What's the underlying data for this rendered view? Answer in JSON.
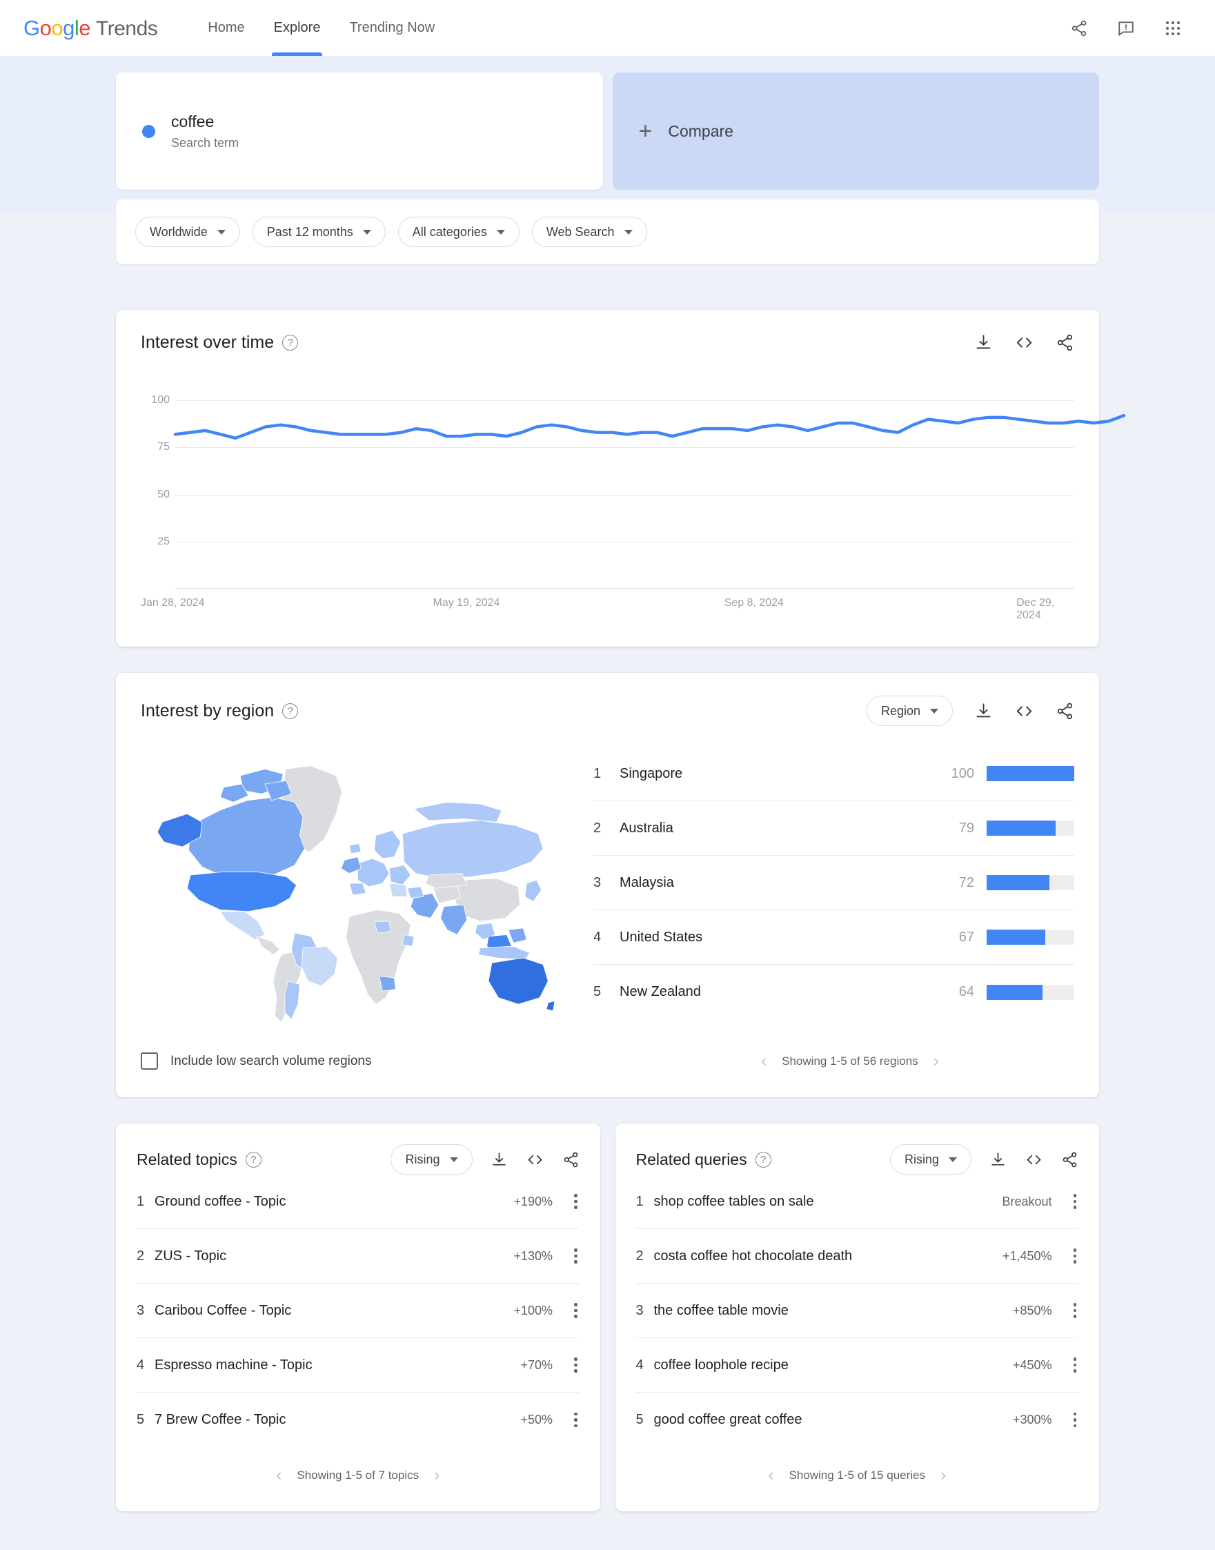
{
  "header": {
    "logo": {
      "g1": "G",
      "o1": "o",
      "o2": "o",
      "g2": "g",
      "l1": "l",
      "e1": "e",
      "trends": "Trends"
    },
    "nav": [
      {
        "label": "Home",
        "active": false
      },
      {
        "label": "Explore",
        "active": true
      },
      {
        "label": "Trending Now",
        "active": false
      }
    ],
    "icons": [
      "share-icon",
      "feedback-icon",
      "apps-grid-icon"
    ]
  },
  "query": {
    "term": "coffee",
    "term_type": "Search term",
    "compare_label": "Compare",
    "compare_plus": "+"
  },
  "filters": [
    {
      "label": "Worldwide",
      "name": "location-filter"
    },
    {
      "label": "Past 12 months",
      "name": "time-filter"
    },
    {
      "label": "All categories",
      "name": "category-filter"
    },
    {
      "label": "Web Search",
      "name": "search-type-filter"
    }
  ],
  "interest_over_time": {
    "title": "Interest over time",
    "help": "?"
  },
  "interest_by_region": {
    "title": "Interest by region",
    "help": "?",
    "selector": "Region",
    "checkbox_label": "Include low search volume regions",
    "pagination": "Showing 1-5 of 56 regions",
    "rows": [
      {
        "rank": "1",
        "name": "Singapore",
        "value": "100",
        "pct": 100
      },
      {
        "rank": "2",
        "name": "Australia",
        "value": "79",
        "pct": 79
      },
      {
        "rank": "3",
        "name": "Malaysia",
        "value": "72",
        "pct": 72
      },
      {
        "rank": "4",
        "name": "United States",
        "value": "67",
        "pct": 67
      },
      {
        "rank": "5",
        "name": "New Zealand",
        "value": "64",
        "pct": 64
      }
    ]
  },
  "related_topics": {
    "title": "Related topics",
    "help": "?",
    "selector": "Rising",
    "pagination": "Showing 1-5 of 7 topics",
    "rows": [
      {
        "rank": "1",
        "name": "Ground coffee - Topic",
        "value": "+190%"
      },
      {
        "rank": "2",
        "name": "ZUS - Topic",
        "value": "+130%"
      },
      {
        "rank": "3",
        "name": "Caribou Coffee - Topic",
        "value": "+100%"
      },
      {
        "rank": "4",
        "name": "Espresso machine - Topic",
        "value": "+70%"
      },
      {
        "rank": "5",
        "name": "7 Brew Coffee - Topic",
        "value": "+50%"
      }
    ]
  },
  "related_queries": {
    "title": "Related queries",
    "help": "?",
    "selector": "Rising",
    "pagination": "Showing 1-5 of 15 queries",
    "rows": [
      {
        "rank": "1",
        "name": "shop coffee tables on sale",
        "value": "Breakout"
      },
      {
        "rank": "2",
        "name": "costa coffee hot chocolate death",
        "value": "+1,450%"
      },
      {
        "rank": "3",
        "name": "the coffee table movie",
        "value": "+850%"
      },
      {
        "rank": "4",
        "name": "coffee loophole recipe",
        "value": "+450%"
      },
      {
        "rank": "5",
        "name": "good coffee great coffee",
        "value": "+300%"
      }
    ]
  },
  "pager_icons": {
    "prev": "‹",
    "next": "›"
  },
  "colors": {
    "accent": "#4285F4",
    "band_bg": "#e8eefc",
    "page_bg": "#eef1f8",
    "bar_track": "#eeeeee",
    "map_none": "#dadce0"
  },
  "chart_data": {
    "type": "line",
    "title": "Interest over time",
    "xlabel": "",
    "ylabel": "",
    "ylim": [
      0,
      110
    ],
    "yticks": [
      100,
      75,
      50,
      25
    ],
    "grid": true,
    "legend": null,
    "xtick_labels": [
      "Jan 28, 2024",
      "May 19, 2024",
      "Sep 8, 2024",
      "Dec 29, 2024"
    ],
    "xtick_positions": [
      0,
      0.308,
      0.615,
      0.923
    ],
    "series": [
      {
        "name": "coffee",
        "color": "#4285F4",
        "values": [
          82,
          83,
          84,
          82,
          80,
          83,
          86,
          87,
          86,
          84,
          83,
          82,
          82,
          82,
          82,
          83,
          85,
          84,
          81,
          81,
          82,
          82,
          81,
          83,
          86,
          87,
          86,
          84,
          83,
          83,
          82,
          83,
          83,
          81,
          83,
          85,
          85,
          85,
          84,
          86,
          87,
          86,
          84,
          86,
          88,
          88,
          86,
          84,
          83,
          87,
          90,
          89,
          88,
          90,
          91,
          91,
          90,
          89,
          88,
          88,
          89,
          88,
          89,
          92
        ]
      }
    ]
  }
}
